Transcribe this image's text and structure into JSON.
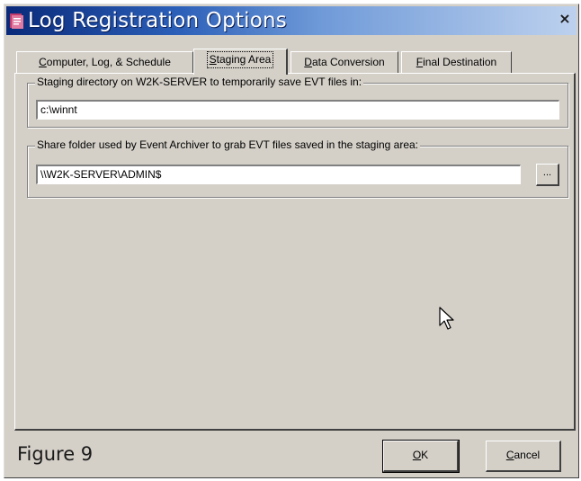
{
  "window": {
    "title": "Log Registration Options",
    "close_glyph": "×",
    "icon": "app-icon"
  },
  "tabs": [
    {
      "label": "Computer, Log, & Schedule",
      "mnemonic": "C",
      "selected": false
    },
    {
      "label": "Staging Area",
      "mnemonic": "S",
      "selected": true
    },
    {
      "label": "Data Conversion",
      "mnemonic": "D",
      "selected": false
    },
    {
      "label": "Final Destination",
      "mnemonic": "F",
      "selected": false
    }
  ],
  "staging_group": {
    "label": "Staging directory on W2K-SERVER to temporarily save EVT files in:",
    "value": "c:\\winnt"
  },
  "share_group": {
    "label": "Share folder used by Event Archiver to grab EVT files saved in the staging area:",
    "value": "\\\\W2K-SERVER\\ADMIN$",
    "browse_label": "..."
  },
  "footer": {
    "figure_label": "Figure 9",
    "ok_label": "OK",
    "cancel_label": "Cancel"
  },
  "colors": {
    "dialog_face": "#d4d0c8",
    "title_gradient_start": "#0a2a7a",
    "title_gradient_end": "#bdd1ee"
  }
}
